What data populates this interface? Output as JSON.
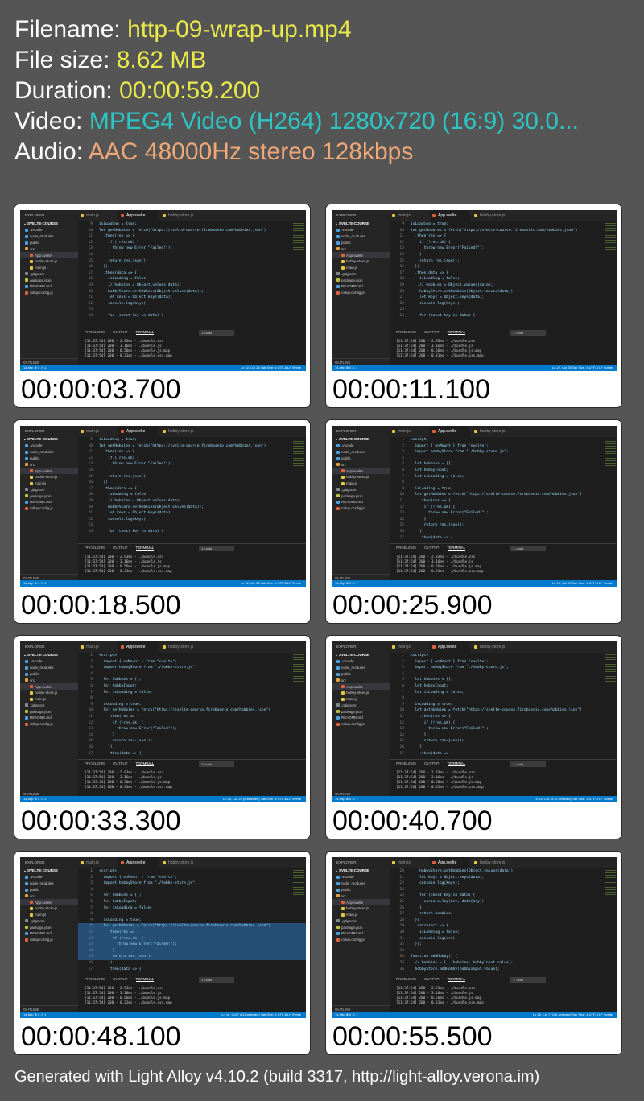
{
  "info": {
    "filename_label": "Filename: ",
    "filename": "http-09-wrap-up.mp4",
    "size_label": "File size: ",
    "size": "8.62 MB",
    "duration_label": "Duration: ",
    "duration": "00:00:59.200",
    "video_label": "Video: ",
    "video": "MPEG4 Video (H264) 1280x720 (16:9) 30.0...",
    "audio_label": "Audio: ",
    "audio": "AAC 48000Hz stereo 128kbps"
  },
  "editor": {
    "explorer": "EXPLORER",
    "project": "SVELTE-COURSE",
    "files": [
      ".vscode",
      "node_modules",
      "public",
      "src",
      "App.svelte",
      "hobby-store.js",
      "main.js",
      ".gitignore",
      "package.json",
      "README.md",
      "rollup.config.js"
    ],
    "outline": "OUTLINE",
    "tabs": [
      "main.js",
      "App.svelte",
      "hobby-store.js"
    ],
    "panel_tabs": [
      "PROBLEMS",
      "OUTPUT",
      "TERMINAL"
    ],
    "panel_select": "1: node",
    "terminal": [
      "[11:37:54] 200 - 2.93ms - ./bundle.css",
      "[11:37:54] 200 - 3.16ms - ./bundle.js",
      "[11:37:54] 200 - 0.56ms - ./bundle.js.map",
      "[11:37:54] 200 - 0.31ms - ./bundle.css.map"
    ],
    "status_left": "14-http  ⊗ 0 ⚠ 1",
    "status_right": "Tab Size: 4   UTF-8   LF   Svelte"
  },
  "code_a": [
    {
      "n": "9",
      "t": "isLoading = true;"
    },
    {
      "n": "10",
      "t": "let getHobbies = fetch(\"https://svelte-course.firebaseio.com/hobbies.json\")"
    },
    {
      "n": "11",
      "t": "  .then(res => {"
    },
    {
      "n": "12",
      "t": "    if (!res.ok) {"
    },
    {
      "n": "13",
      "t": "      throw new Error(\"Failed!\");"
    },
    {
      "n": "14",
      "t": "    }"
    },
    {
      "n": "15",
      "t": "    return res.json();"
    },
    {
      "n": "16",
      "t": "  })"
    },
    {
      "n": "17",
      "t": "  .then(data => {"
    },
    {
      "n": "18",
      "t": "    isLoading = false;"
    },
    {
      "n": "19",
      "t": "    // hobbies = Object.values(data);"
    },
    {
      "n": "20",
      "t": "    hobbyStore.setHobbies(Object.values(data));"
    },
    {
      "n": "21",
      "t": "    let keys = Object.keys(data);"
    },
    {
      "n": "22",
      "t": "    console.log(keys);"
    },
    {
      "n": "23",
      "t": ""
    },
    {
      "n": "24",
      "t": "    for (const key in data) {"
    }
  ],
  "code_b": [
    {
      "n": "1",
      "t": "<script>"
    },
    {
      "n": "2",
      "t": "  import { onMount } from \"svelte\";"
    },
    {
      "n": "3",
      "t": "  import hobbyStore from \"./hobby-store.js\";"
    },
    {
      "n": "4",
      "t": ""
    },
    {
      "n": "5",
      "t": "  let hobbies = [];"
    },
    {
      "n": "6",
      "t": "  let hobbyInput;"
    },
    {
      "n": "7",
      "t": "  let isLoading = false;"
    },
    {
      "n": "8",
      "t": ""
    },
    {
      "n": "9",
      "t": "  isLoading = true;"
    },
    {
      "n": "10",
      "t": "  let getHobbies = fetch(\"https://svelte-course.firebaseio.com/hobbies.json\")"
    },
    {
      "n": "11",
      "t": "    .then(res => {"
    },
    {
      "n": "12",
      "t": "      if (!res.ok) {"
    },
    {
      "n": "13",
      "t": "        throw new Error(\"Failed!\");"
    },
    {
      "n": "14",
      "t": "      }"
    },
    {
      "n": "15",
      "t": "      return res.json();"
    },
    {
      "n": "16",
      "t": "    })"
    },
    {
      "n": "17",
      "t": "    .then(data => {"
    }
  ],
  "code_c": [
    {
      "n": "20",
      "t": "    hobbyStore.setHobbies(Object.values(data));"
    },
    {
      "n": "21",
      "t": "    let keys = Object.keys(data);"
    },
    {
      "n": "22",
      "t": "    console.log(keys);"
    },
    {
      "n": "23",
      "t": ""
    },
    {
      "n": "24",
      "t": "    for (const key in data) {"
    },
    {
      "n": "25",
      "t": "      console.log(key, data[key]);"
    },
    {
      "n": "26",
      "t": "    }"
    },
    {
      "n": "27",
      "t": "    return hobbies;"
    },
    {
      "n": "28",
      "t": "  })"
    },
    {
      "n": "29",
      "t": "  .catch(err => {"
    },
    {
      "n": "30",
      "t": "    isLoading = false;"
    },
    {
      "n": "31",
      "t": "    console.log(err);"
    },
    {
      "n": "32",
      "t": "  });"
    },
    {
      "n": "33",
      "t": ""
    },
    {
      "n": "34",
      "t": "function addHobby() {"
    },
    {
      "n": "35",
      "t": "  // hobbies = [...hobbies, hobbyInput.value];"
    },
    {
      "n": "36",
      "t": "  hobbyStore.addHobby(hobbyInput.value);"
    }
  ],
  "thumbs": [
    {
      "time": "00:00:03.700",
      "code": "a",
      "status": "Ln 22, Col 25"
    },
    {
      "time": "00:00:11.100",
      "code": "a",
      "status": "Ln 22, Col 25"
    },
    {
      "time": "00:00:18.500",
      "code": "a",
      "status": "Ln 22, Col 25"
    },
    {
      "time": "00:00:25.900",
      "code": "b",
      "status": "Ln 10, Col 20"
    },
    {
      "time": "00:00:33.300",
      "code": "b",
      "status": "Ln 10, Col 25 (5 selected)"
    },
    {
      "time": "00:00:40.700",
      "code": "b",
      "status": "Ln 10, Col 25 (5 selected)"
    },
    {
      "time": "00:00:48.100",
      "code": "b",
      "status": "Ln 16, Col 7 (111 selected)"
    },
    {
      "time": "00:00:55.500",
      "code": "c",
      "status": "Ln 16, Col 7 (106 selected)"
    }
  ],
  "footer": "Generated with Light Alloy v4.10.2 (build 3317, http://light-alloy.verona.im)",
  "colors": {
    "background": "#555555",
    "value_yellow": "#e9e94a",
    "value_cyan": "#2ec4c4",
    "value_orange": "#f0a878",
    "status_blue": "#007acc"
  }
}
